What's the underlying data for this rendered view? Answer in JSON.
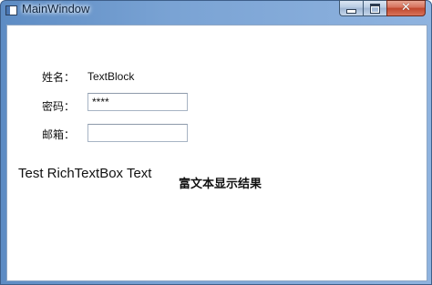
{
  "window": {
    "title": "MainWindow",
    "minimize_icon": "minimize-icon",
    "maximize_icon": "maximize-icon",
    "close_icon": "close-icon",
    "close_glyph": "✕"
  },
  "form": {
    "name_label": "姓名：",
    "name_value": "TextBlock",
    "password_label": "密码：",
    "password_value": "****",
    "email_label": "邮箱：",
    "email_value": ""
  },
  "richtext": {
    "text": "Test RichTextBox Text",
    "result": "富文本显示结果"
  }
}
